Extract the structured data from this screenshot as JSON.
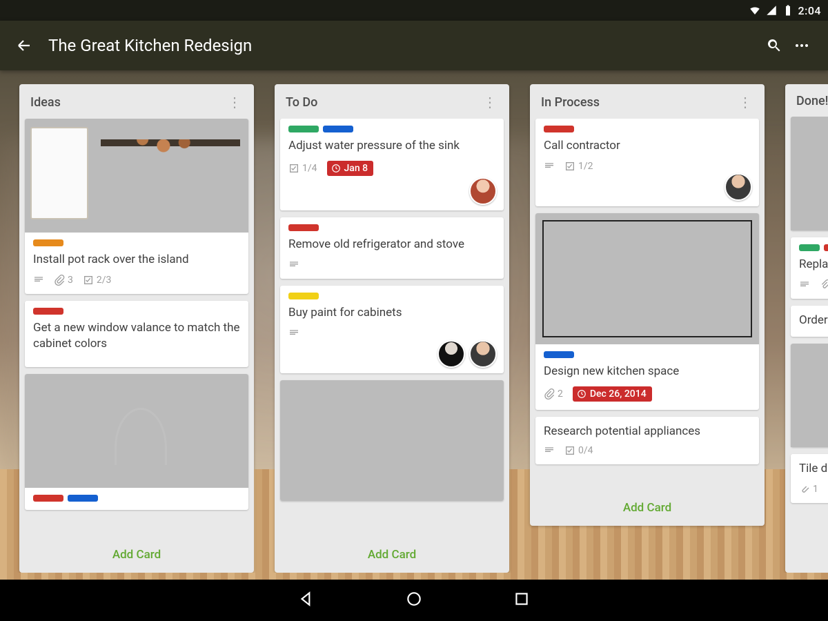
{
  "status": {
    "time": "2:04"
  },
  "header": {
    "title": "The Great Kitchen Redesign"
  },
  "add_card_label": "Add Card",
  "lists": [
    {
      "name": "Ideas",
      "cards": [
        {
          "title": "Install pot rack over the island",
          "labels": [
            "orange"
          ],
          "attachments": "3",
          "checklist": "2/3",
          "has_desc": true
        },
        {
          "title": "Get a new window valance to match the cabinet colors",
          "labels": [
            "red"
          ]
        }
      ]
    },
    {
      "name": "To Do",
      "cards": [
        {
          "title": "Adjust water pressure of the sink",
          "labels": [
            "green",
            "blue"
          ],
          "checklist": "1/4",
          "due": "Jan 8"
        },
        {
          "title": "Remove old refrigerator and stove",
          "labels": [
            "red"
          ],
          "has_desc": true
        },
        {
          "title": "Buy paint for cabinets",
          "labels": [
            "yellow"
          ],
          "has_desc": true
        }
      ]
    },
    {
      "name": "In Process",
      "cards": [
        {
          "title": "Call contractor",
          "labels": [
            "red"
          ],
          "has_desc": true,
          "checklist": "1/2"
        },
        {
          "title": "Design new kitchen space",
          "labels": [
            "blue"
          ],
          "attachments": "2",
          "due": "Dec 26, 2014"
        },
        {
          "title": "Research potential appliances",
          "has_desc": true,
          "checklist": "0/4"
        }
      ]
    },
    {
      "name": "Done!",
      "cards": [
        {
          "title": "Replace old ones",
          "labels": [
            "green",
            "red"
          ],
          "has_desc": true,
          "attachments": ""
        },
        {
          "title": "Order glass"
        },
        {
          "title": "Tile delivery",
          "attachments": "1"
        }
      ]
    }
  ]
}
